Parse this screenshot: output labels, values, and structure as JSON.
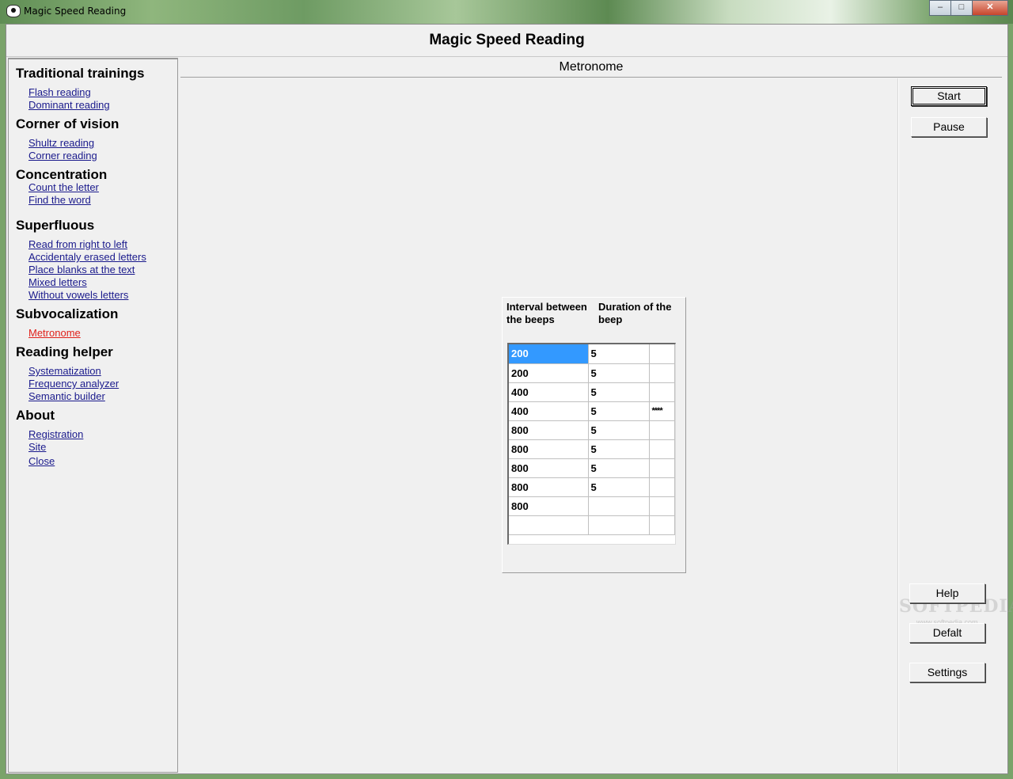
{
  "window": {
    "title": "Magic Speed Reading",
    "buttons": [
      "–",
      "□",
      "✕"
    ]
  },
  "app": {
    "title": "Magic Speed Reading"
  },
  "sidebar": {
    "sections": [
      {
        "title": "Traditional trainings",
        "links": [
          "Flash reading",
          "Dominant reading"
        ]
      },
      {
        "title": "Corner of vision",
        "links": [
          "Shultz reading",
          "Corner reading"
        ]
      },
      {
        "title": "Concentration",
        "links": [
          "Count the letter",
          "Find the word"
        ]
      },
      {
        "title": "Superfluous",
        "links": [
          "Read from right to left",
          "Accidentaly erased letters",
          "Place blanks at the text",
          "Mixed letters",
          "Without vowels letters"
        ]
      },
      {
        "title": "Subvocalization",
        "links": [
          "Metronome"
        ]
      },
      {
        "title": "Reading helper",
        "links": [
          "Systematization",
          "Frequency analyzer",
          "Semantic builder"
        ]
      },
      {
        "title": "About",
        "links": [
          "Registration",
          "Site",
          "Close"
        ]
      }
    ],
    "active_link": "Metronome"
  },
  "main": {
    "section_title": "Metronome",
    "grid": {
      "headers": [
        "Interval between the beeps",
        "Duration of the beep"
      ],
      "header_lines": [
        [
          "Interval between",
          "the beeps"
        ],
        [
          "Duration of the",
          "beep"
        ]
      ],
      "rows": [
        [
          "200",
          "5",
          ""
        ],
        [
          "200",
          "5",
          ""
        ],
        [
          "400",
          "5",
          ""
        ],
        [
          "400",
          "5",
          "****"
        ],
        [
          "800",
          "5",
          ""
        ],
        [
          "800",
          "5",
          ""
        ],
        [
          "800",
          "5",
          ""
        ],
        [
          "800",
          "5",
          ""
        ],
        [
          "800",
          "",
          ""
        ],
        [
          "",
          "",
          ""
        ]
      ]
    }
  },
  "buttons": {
    "start": "Start",
    "pause": "Pause",
    "help": "Help",
    "default": "Defalt",
    "settings": "Settings"
  },
  "watermark": {
    "text": "SOFTPEDIA",
    "sub": "www.softpedia.com"
  }
}
